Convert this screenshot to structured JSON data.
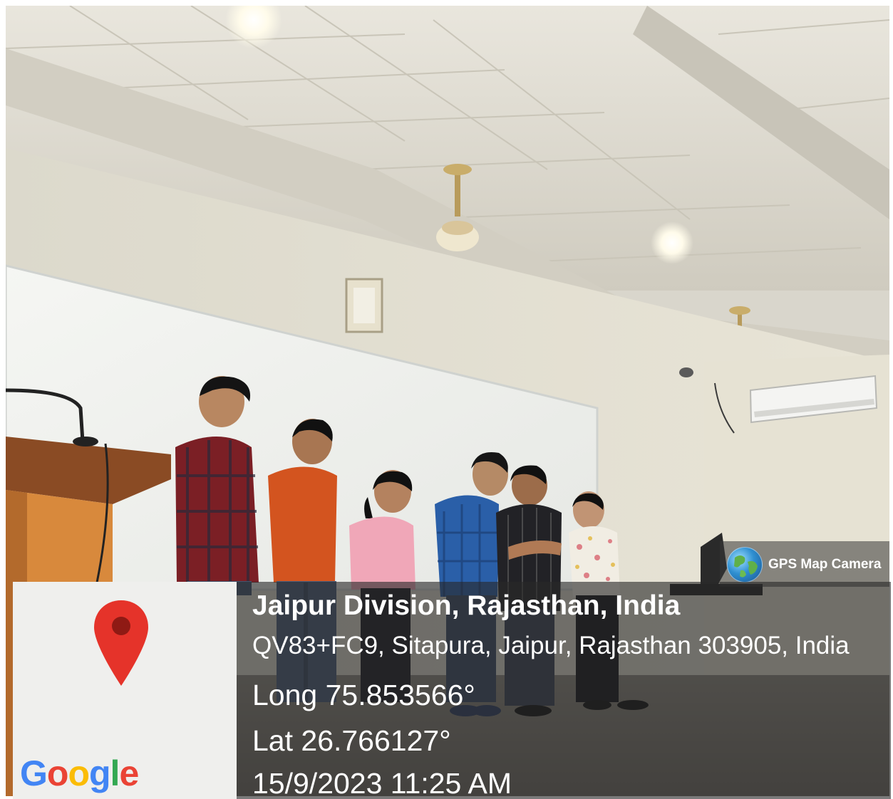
{
  "badge": {
    "label": "GPS Map Camera",
    "icon": "globe-icon"
  },
  "map": {
    "pin_icon": "map-pin-icon",
    "logo_letters": [
      {
        "char": "G",
        "color": "#4285F4"
      },
      {
        "char": "o",
        "color": "#EA4335"
      },
      {
        "char": "o",
        "color": "#FBBC05"
      },
      {
        "char": "g",
        "color": "#4285F4"
      },
      {
        "char": "l",
        "color": "#34A853"
      },
      {
        "char": "e",
        "color": "#EA4335"
      }
    ]
  },
  "location": {
    "title": "Jaipur Division, Rajasthan, India",
    "address": "QV83+FC9, Sitapura, Jaipur, Rajasthan 303905, India",
    "longitude": "Long 75.853566°",
    "latitude": "Lat 26.766127°",
    "timestamp": "15/9/2023 11:25 AM"
  },
  "colors": {
    "pin_red": "#E5332A",
    "overlay": "#282828"
  }
}
